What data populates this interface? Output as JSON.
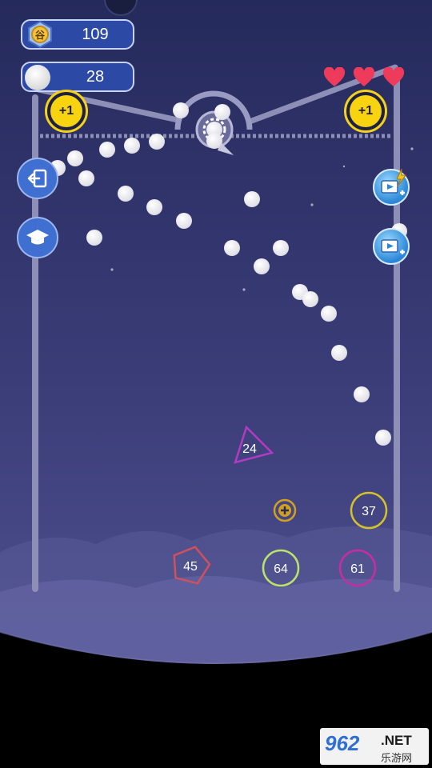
{
  "hud": {
    "coins": "109",
    "coin_icon_char": "谷",
    "balls": "28",
    "lives": 3
  },
  "powerups": {
    "left_bonus": "+1",
    "right_bonus": "+1"
  },
  "targets": [
    {
      "shape": "triangle",
      "value": "24",
      "color": "#b23bc1"
    },
    {
      "shape": "plus",
      "value": "",
      "color": "#d0a020"
    },
    {
      "shape": "circle",
      "value": "37",
      "color": "#d5c12a"
    },
    {
      "shape": "pentagon",
      "value": "45",
      "color": "#d0505c"
    },
    {
      "shape": "circle",
      "value": "64",
      "color": "#b9e36a"
    },
    {
      "shape": "circle",
      "value": "61",
      "color": "#c52ea0"
    }
  ],
  "watermark": {
    "number": "962",
    "brand": ".NET",
    "subtitle": "乐游网"
  },
  "colors": {
    "sky_top": "#2a3064",
    "sky_bottom": "#4b4a86",
    "rail": "#8e8fb6",
    "ball": "#ffffff",
    "heart": "#ee3b5c"
  },
  "icons": {
    "exit": "exit-icon",
    "tutorial": "graduation-cap-icon",
    "video_energy": "video-lightning-icon",
    "video_ball": "video-ball-icon"
  }
}
